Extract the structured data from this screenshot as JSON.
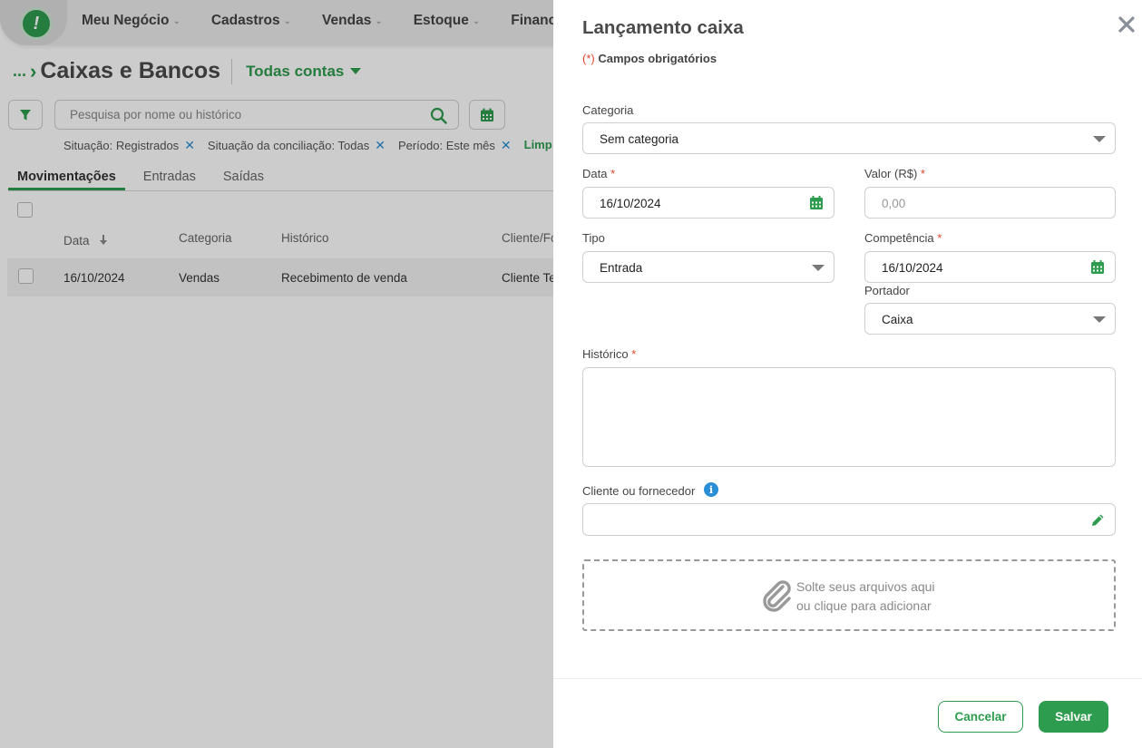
{
  "app": {
    "nav": [
      "Meu Negócio",
      "Cadastros",
      "Vendas",
      "Estoque",
      "Financ"
    ],
    "breadcrumb": {
      "dots": "...",
      "title": "Caixas e Bancos",
      "accounts": "Todas contas"
    },
    "search": {
      "placeholder": "Pesquisa por nome ou histórico"
    },
    "filters": [
      "Situação: Registrados",
      "Situação da conciliação: Todas",
      "Período: Este mês"
    ],
    "filter_clear": "Limp",
    "tabs": [
      "Movimentações",
      "Entradas",
      "Saídas"
    ],
    "table": {
      "headers": [
        "Data",
        "Categoria",
        "Histórico",
        "Cliente/Fo"
      ],
      "rows": [
        {
          "data": "16/10/2024",
          "categoria": "Vendas",
          "historico": "Recebimento de venda",
          "cliente": "Cliente Te"
        }
      ]
    }
  },
  "drawer": {
    "title": "Lançamento caixa",
    "required_mark": "(*)",
    "required_note": "Campos obrigatórios",
    "categoria": {
      "label": "Categoria",
      "value": "Sem categoria"
    },
    "data": {
      "label": "Data",
      "value": "16/10/2024"
    },
    "valor": {
      "label": "Valor (R$)",
      "placeholder": "0,00"
    },
    "tipo": {
      "label": "Tipo",
      "value": "Entrada"
    },
    "competencia": {
      "label": "Competência",
      "value": "16/10/2024"
    },
    "portador": {
      "label": "Portador",
      "value": "Caixa"
    },
    "historico": {
      "label": "Histórico"
    },
    "cliente": {
      "label": "Cliente ou fornecedor",
      "info": "i"
    },
    "dropzone": {
      "line1": "Solte seus arquivos aqui",
      "line2": "ou clique para adicionar"
    },
    "cancel": "Cancelar",
    "save": "Salvar",
    "required_star": "*"
  },
  "colors": {
    "accent": "#2e9c4e",
    "required": "#e0452f",
    "info": "#2a8fd6"
  },
  "icons": [
    "filter-icon",
    "search-icon",
    "calendar-icon",
    "close-icon",
    "sort-down-icon",
    "info-icon",
    "pencil-icon",
    "paperclip-icon",
    "chevron-down-icon"
  ]
}
